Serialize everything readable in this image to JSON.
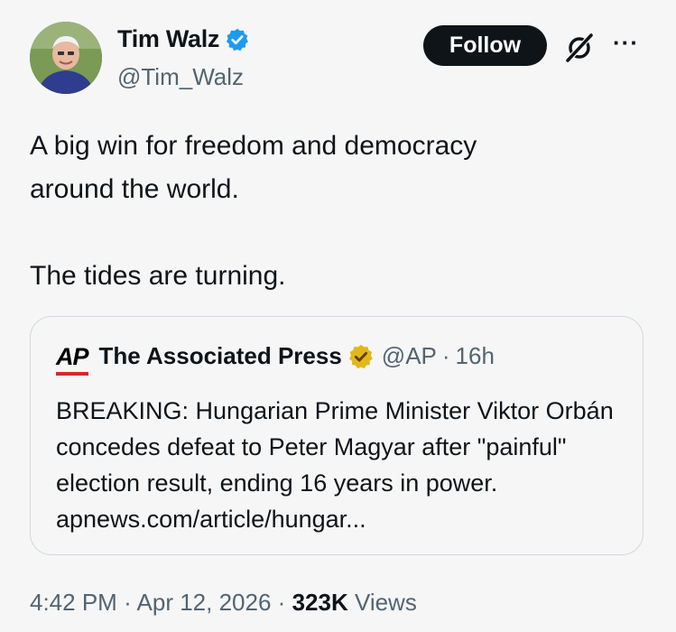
{
  "author": {
    "display_name": "Tim Walz",
    "handle": "@Tim_Walz",
    "follow_label": "Follow",
    "more_label": "···"
  },
  "tweet": {
    "text": "A big win for freedom and democracy\naround the world.\n\nThe tides are turning."
  },
  "quote": {
    "logo_text": "AP",
    "display_name": "The Associated Press",
    "handle": "@AP",
    "separator": "·",
    "age": "16h",
    "text": "BREAKING: Hungarian Prime Minister Viktor Orbán concedes defeat to Peter Magyar after \"painful\" election result, ending 16 years in power. apnews.com/article/hungar..."
  },
  "footer": {
    "time": "4:42 PM",
    "separator": "·",
    "date": "Apr 12, 2026",
    "views_count": "323K",
    "views_label": "Views"
  },
  "colors": {
    "verified_blue": "#1d9bf0",
    "gold_badge": "#e2b719",
    "ap_red": "#d12b2b"
  },
  "icons": [
    "verified-badge-icon",
    "grok-icon",
    "more-icon",
    "gold-verified-badge-icon"
  ]
}
